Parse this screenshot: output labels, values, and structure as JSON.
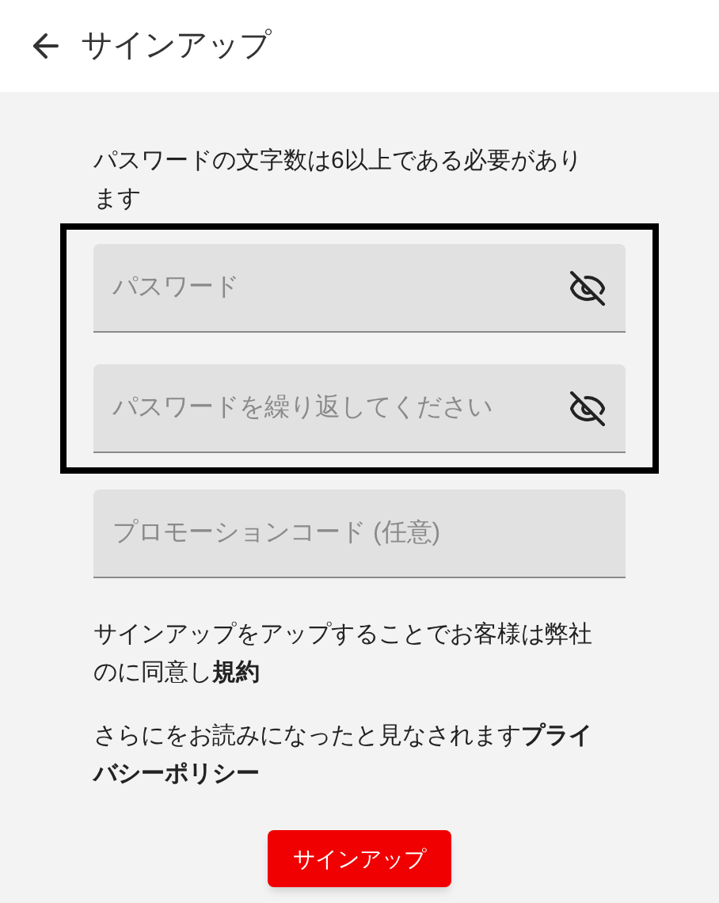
{
  "header": {
    "title": "サインアップ"
  },
  "password_rule": "パスワードの文字数は6以上である必要があります",
  "highlight": {
    "shown": true
  },
  "fields": [
    {
      "placeholder": "パスワード",
      "kind": "password"
    },
    {
      "placeholder": "パスワードを繰り返してください",
      "kind": "password"
    },
    {
      "placeholder": "プロモーションコード (任意)",
      "kind": "text"
    }
  ],
  "terms_text": "サインアップをアップすることでお客様は弊社のに同意し**規約**",
  "privacy_text": "さらにをお読みになったと見なされます**プライバシーポリシー**",
  "submit_button": "サインアップ"
}
